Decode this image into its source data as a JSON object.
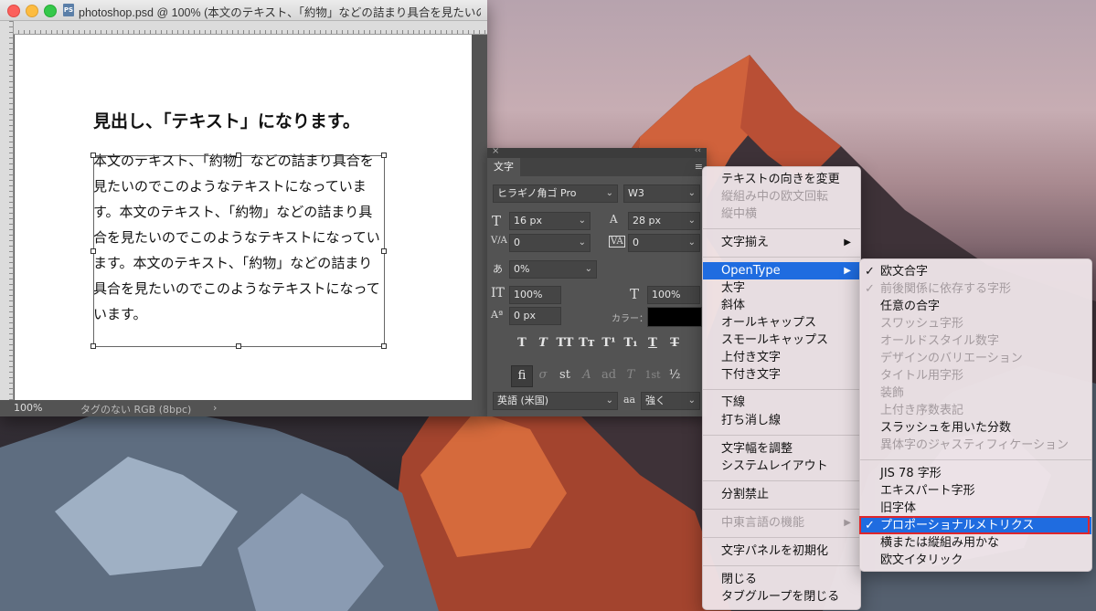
{
  "window": {
    "title": "photoshop.psd @ 100% (本文のテキスト、「約物」などの詰まり具合を見たいの…",
    "doc_icon": "PS"
  },
  "canvas": {
    "heading": "見出し、「テキスト」になります。",
    "body_text": "本文のテキスト、「約物」などの詰まり具合を見たいのでこのようなテキストになっています。本文のテキスト、「約物」などの詰まり具合を見たいのでこのようなテキストになっています。本文のテキスト、「約物」などの詰まり具合を見たいのでこのようなテキストになっています。"
  },
  "statusbar": {
    "zoom": "100%",
    "color_profile": "タグのない RGB (8bpc)",
    "arrow": "›"
  },
  "char_panel": {
    "close": "×",
    "collapse": "‹‹",
    "tab_label": "文字",
    "menu_icon": "≡",
    "font_family": "ヒラギノ角ゴ Pro",
    "font_style": "W3",
    "font_size": "16 px",
    "leading": "28 px",
    "kerning": "0",
    "tracking": "0",
    "tsume": "0%",
    "vertical_scale": "100%",
    "horizontal_scale": "100%",
    "baseline_shift": "0 px",
    "color_label": "カラー：",
    "language": "英語 (米国)",
    "antialias": "強く",
    "style_buttons": [
      "T",
      "T",
      "TT",
      "Tт",
      "T¹",
      "T₁",
      "T",
      "T"
    ],
    "ot_buttons": [
      "fi",
      "σ",
      "st",
      "A",
      "ad",
      "T",
      "1st",
      "½"
    ],
    "icons": {
      "font_size": "T",
      "leading": "A",
      "kerning": "V/A",
      "tracking": "VA",
      "tsume": "あ",
      "vertical_scale": "IT",
      "horizontal_scale": "T",
      "baseline": "Aª",
      "antialias": "aa"
    },
    "dropdown_arrow": "⌄"
  },
  "main_menu": {
    "items": [
      {
        "label": "テキストの向きを変更",
        "disabled": false
      },
      {
        "label": "縦組み中の欧文回転",
        "disabled": true
      },
      {
        "label": "縦中横",
        "disabled": true
      },
      {
        "label": "文字揃え",
        "disabled": false,
        "submenu": true
      },
      {
        "label": "OpenType",
        "disabled": false,
        "submenu": true,
        "highlight": true
      },
      {
        "label": "太字",
        "disabled": false
      },
      {
        "label": "斜体",
        "disabled": false
      },
      {
        "label": "オールキャップス",
        "disabled": false
      },
      {
        "label": "スモールキャップス",
        "disabled": false
      },
      {
        "label": "上付き文字",
        "disabled": false
      },
      {
        "label": "下付き文字",
        "disabled": false
      },
      {
        "label": "下線",
        "disabled": false
      },
      {
        "label": "打ち消し線",
        "disabled": false
      },
      {
        "label": "文字幅を調整",
        "disabled": false
      },
      {
        "label": "システムレイアウト",
        "disabled": false
      },
      {
        "label": "分割禁止",
        "disabled": false
      },
      {
        "label": "中東言語の機能",
        "disabled": true,
        "submenu": true
      },
      {
        "label": "文字パネルを初期化",
        "disabled": false
      },
      {
        "label": "閉じる",
        "disabled": false
      },
      {
        "label": "タブグループを閉じる",
        "disabled": false
      }
    ],
    "submenu_arrow": "▶"
  },
  "opentype_menu": {
    "check_mark": "✓",
    "items": [
      {
        "label": "欧文合字",
        "checked": true,
        "disabled": false
      },
      {
        "label": "前後関係に依存する字形",
        "checked": true,
        "disabled": true
      },
      {
        "label": "任意の合字",
        "checked": false,
        "disabled": false
      },
      {
        "label": "スワッシュ字形",
        "checked": false,
        "disabled": true
      },
      {
        "label": "オールドスタイル数字",
        "checked": false,
        "disabled": true
      },
      {
        "label": "デザインのバリエーション",
        "checked": false,
        "disabled": true
      },
      {
        "label": "タイトル用字形",
        "checked": false,
        "disabled": true
      },
      {
        "label": "装飾",
        "checked": false,
        "disabled": true
      },
      {
        "label": "上付き序数表記",
        "checked": false,
        "disabled": true
      },
      {
        "label": "スラッシュを用いた分数",
        "checked": false,
        "disabled": false
      },
      {
        "label": "異体字のジャスティフィケーション",
        "checked": false,
        "disabled": true
      },
      {
        "label": "JIS 78 字形",
        "checked": false,
        "disabled": false
      },
      {
        "label": "エキスパート字形",
        "checked": false,
        "disabled": false
      },
      {
        "label": "旧字体",
        "checked": false,
        "disabled": false
      },
      {
        "label": "プロポーショナルメトリクス",
        "checked": true,
        "disabled": false,
        "highlight": true
      },
      {
        "label": "横または縦組み用かな",
        "checked": false,
        "disabled": false
      },
      {
        "label": "欧文イタリック",
        "checked": false,
        "disabled": false
      }
    ]
  }
}
